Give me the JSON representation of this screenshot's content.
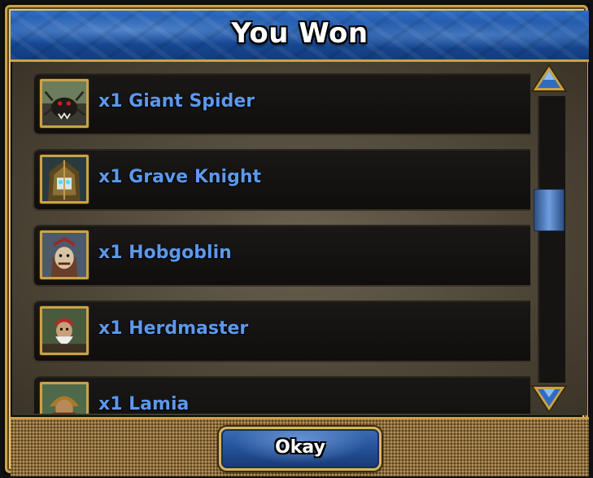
{
  "dialog": {
    "title": "You Won"
  },
  "rewards": [
    {
      "label": "x1 Giant Spider",
      "icon": "giant-spider-portrait"
    },
    {
      "label": "x1 Grave Knight",
      "icon": "grave-knight-portrait"
    },
    {
      "label": "x1 Hobgoblin",
      "icon": "hobgoblin-portrait"
    },
    {
      "label": "x1 Herdmaster",
      "icon": "herdmaster-portrait"
    },
    {
      "label": "x1 Lamia",
      "icon": "lamia-portrait"
    }
  ],
  "scrollbar": {
    "up_icon": "triangle-up-icon",
    "down_icon": "triangle-down-icon"
  },
  "footer": {
    "okay_label": "Okay"
  },
  "colors": {
    "accent_gold": "#c9a24a",
    "title_blue": "#1a4e9d",
    "reward_text": "#5d98ec"
  }
}
